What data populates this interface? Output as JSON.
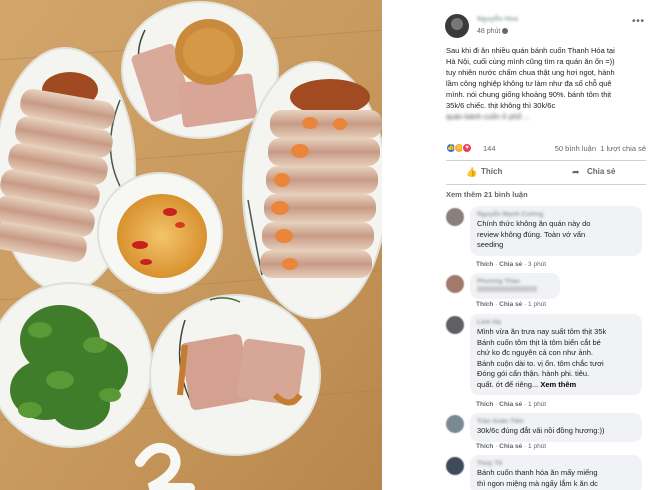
{
  "post": {
    "author": "Nguyễn Hoa",
    "time": "48 phút",
    "text_lines": [
      "Sau khi đi ăn nhiều quán bánh cuốn Thanh Hóa tại",
      "Hà Nội, cuối cùng mình cũng tìm ra quán ăn ổn =))",
      "tuy nhiên nước chấm chua thật ung hơi ngot, hành",
      "lầm công nghiệp không tư làm như đa số chỗ quê",
      "mình. nói chung giống khoảng 90%. bánh tôm thịt",
      "35k/6 chiếc. thịt không thì 30k/6c"
    ],
    "hidden_line": "quán bánh cuốn ở phố ..."
  },
  "reactions": {
    "count": "144",
    "comments": "50 bình luận",
    "shares": "1 lượt chia sẻ"
  },
  "actions": {
    "like": "Thích",
    "share": "Chia sẻ"
  },
  "more_comments": "Xem thêm 21 bình luận",
  "comments": [
    {
      "name": "Nguyễn Mạnh Cường",
      "avatar_color": "#8a7f7c",
      "lines": [
        "Chính thức không ăn quán này do",
        "review không đúng. Toàn vớ vẩn",
        "seeding"
      ],
      "like": "Thích",
      "share": "Chia sẻ",
      "time": "3 phút"
    },
    {
      "name": "Phương Thảo",
      "avatar_color": "#a07a6a",
      "lines": [],
      "like": "Thích",
      "share": "Chia sẻ",
      "time": "1 phút"
    },
    {
      "name": "Linh Hà",
      "avatar_color": "#5f5f66",
      "lines": [
        "Mình vừa ăn trưa nay suất tôm thịt 35k",
        "Bánh cuốn tôm thịt là tôm biển cắt bé",
        "chứ ko đc nguyên cả con như ảnh.",
        "Bánh cuộn dài to. vị ổn. tôm chắc tươi",
        "Đóng gói cẩn thận. hành phi. tiêu.",
        "quất. ớt để riêng..."
      ],
      "see_more": "Xem thêm",
      "like": "Thích",
      "share": "Chia sẻ",
      "time": "1 phút"
    },
    {
      "name": "Trần Xuân Tiến",
      "avatar_color": "#7a8a94",
      "lines": [
        "30k/6c đúng đắt vãi nồi đồng hương:))"
      ],
      "like": "Thích",
      "share": "Chia sẻ",
      "time": "1 phút"
    },
    {
      "name": "Thùy Tô",
      "avatar_color": "#3f4a5a",
      "lines": [
        "Bánh cuốn thanh hóa ăn mấy miếng",
        "thì ngon miệng mà ngấy lắm k ăn dc"
      ],
      "like": "Thích",
      "share": "Chia sẻ",
      "time": "1 phút"
    }
  ]
}
